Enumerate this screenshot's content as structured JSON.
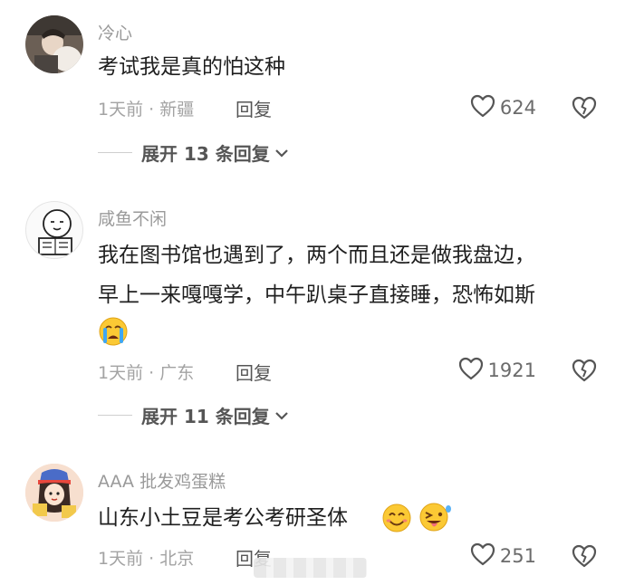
{
  "comments": [
    {
      "username": "冷心",
      "lines": [
        "考试我是真的怕这种"
      ],
      "meta": "1天前 · 新疆",
      "reply_label": "回复",
      "likes": "624",
      "expand_label": "展开 13 条回复"
    },
    {
      "username": "咸鱼不闲",
      "lines": [
        "我在图书馆也遇到了，两个而且还是做我盘边，",
        "早上一来嘎嘎学，中午趴桌子直接睡，恐怖如斯"
      ],
      "emoji": "crying-face-emoji",
      "meta": "1天前 · 广东",
      "reply_label": "回复",
      "likes": "1921",
      "expand_label": "展开 11 条回复"
    },
    {
      "username": "AAA 批发鸡蛋糕",
      "lines": [
        "山东小土豆是考公考研圣体"
      ],
      "emoji": [
        "smiling-face-emoji",
        "winking-tongue-emoji"
      ],
      "meta": "1天前 · 北京",
      "reply_label": "回复",
      "likes": "251"
    }
  ],
  "icons": {
    "like": "heart-outline-icon",
    "dislike": "broken-heart-icon",
    "expand": "chevron-down-icon"
  },
  "colors": {
    "username": "#9a9a9a",
    "text": "#1f1f1f",
    "meta": "#a3a3a3",
    "count": "#6b6b6b"
  }
}
